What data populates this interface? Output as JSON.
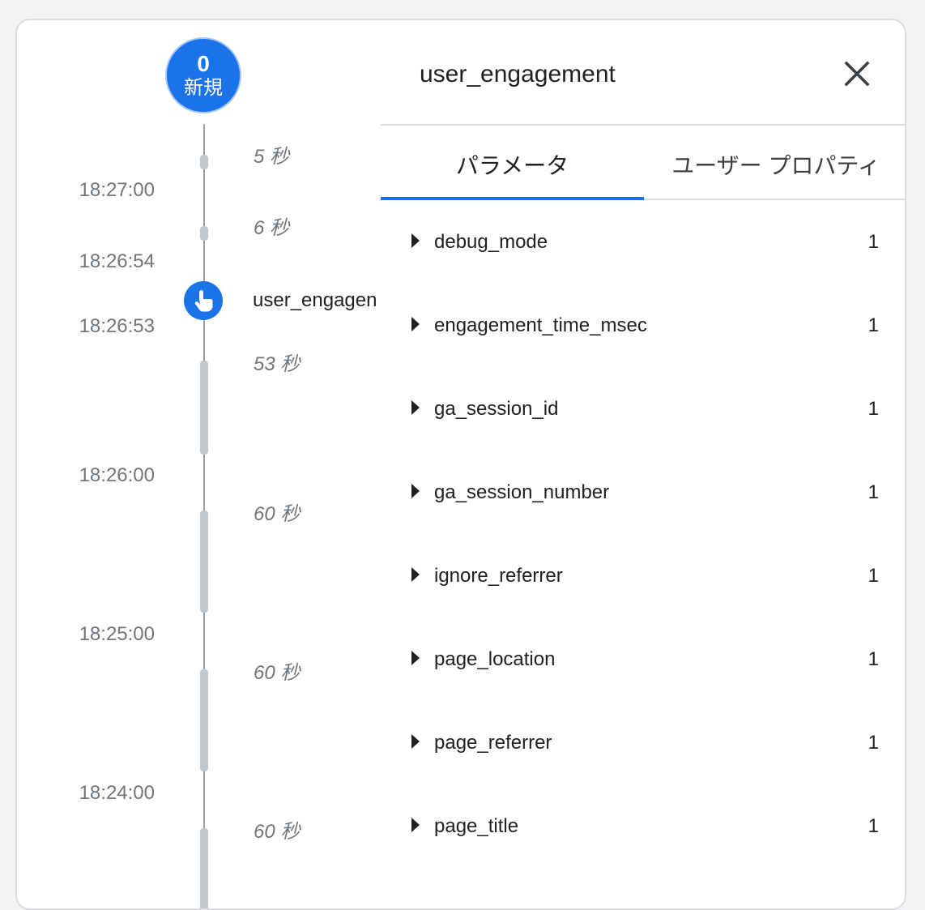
{
  "timeline": {
    "counter": {
      "count": "0",
      "label": "新規"
    },
    "times": [
      "18:27:00",
      "18:26:54",
      "18:26:53",
      "18:26:00",
      "18:25:00",
      "18:24:00"
    ],
    "durations": [
      "5 秒",
      "6 秒",
      "53 秒",
      "60 秒",
      "60 秒",
      "60 秒"
    ],
    "event": {
      "name": "user_engagen",
      "icon": "touch-icon"
    }
  },
  "panel": {
    "title": "user_engagement",
    "close_icon": "close-icon",
    "tabs": [
      {
        "label": "パラメータ",
        "active": true
      },
      {
        "label": "ユーザー プロパティ",
        "active": false
      }
    ],
    "params": [
      {
        "name": "debug_mode",
        "count": "1"
      },
      {
        "name": "engagement_time_msec",
        "count": "1"
      },
      {
        "name": "ga_session_id",
        "count": "1"
      },
      {
        "name": "ga_session_number",
        "count": "1"
      },
      {
        "name": "ignore_referrer",
        "count": "1"
      },
      {
        "name": "page_location",
        "count": "1"
      },
      {
        "name": "page_referrer",
        "count": "1"
      },
      {
        "name": "page_title",
        "count": "1"
      }
    ]
  },
  "colors": {
    "accent": "#1a73e8",
    "muted_text": "#70757a",
    "divider": "#dadce0"
  }
}
